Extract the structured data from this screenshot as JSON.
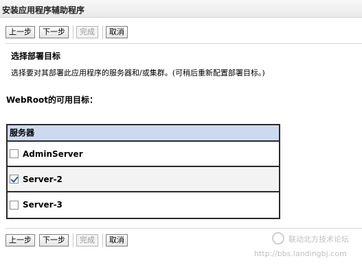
{
  "window": {
    "title": "安装应用程序辅助程序"
  },
  "toolbar": {
    "back_label": "上一步",
    "next_label": "下一步",
    "finish_label": "完成",
    "cancel_label": "取消"
  },
  "section": {
    "heading": "选择部署目标",
    "description": "选择要对其部署此应用程序的服务器和/或集群。(可稍后重新配置部署目标。)"
  },
  "targets": {
    "label": "WebRoot的可用目标：",
    "column_header": "服务器",
    "rows": [
      {
        "name": "AdminServer",
        "checked": false
      },
      {
        "name": "Server-2",
        "checked": true
      },
      {
        "name": "Server-3",
        "checked": false
      }
    ]
  },
  "watermark": {
    "text": "联动北方技术论坛",
    "url": "http://bbs.landingbj.com"
  },
  "colors": {
    "header_bg": "#cdd9ef",
    "check_color": "#2b55a3"
  }
}
